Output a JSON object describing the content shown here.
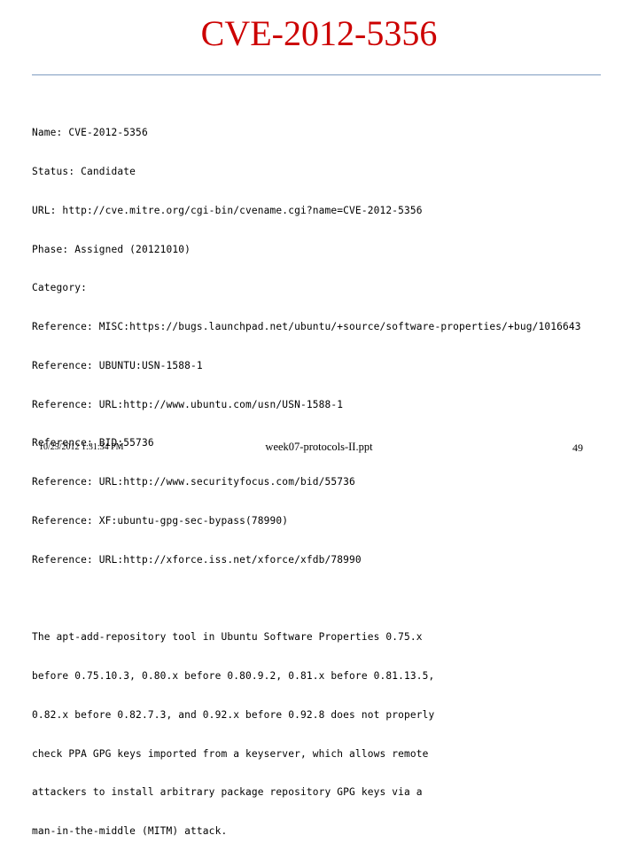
{
  "slide": {
    "title": "CVE-2012-5356",
    "accent_color": "#cc0000",
    "divider_color": "#7f9cc0"
  },
  "record": {
    "fields": [
      "Name: CVE-2012-5356",
      "Status: Candidate",
      "URL: http://cve.mitre.org/cgi-bin/cvename.cgi?name=CVE-2012-5356",
      "Phase: Assigned (20121010)",
      "Category:",
      "Reference: MISC:https://bugs.launchpad.net/ubuntu/+source/software-properties/+bug/1016643",
      "Reference: UBUNTU:USN-1588-1",
      "Reference: URL:http://www.ubuntu.com/usn/USN-1588-1",
      "Reference: BID:55736",
      "Reference: URL:http://www.securityfocus.com/bid/55736",
      "Reference: XF:ubuntu-gpg-sec-bypass(78990)",
      "Reference: URL:http://xforce.iss.net/xforce/xfdb/78990"
    ],
    "description": [
      "The apt-add-repository tool in Ubuntu Software Properties 0.75.x",
      "before 0.75.10.3, 0.80.x before 0.80.9.2, 0.81.x before 0.81.13.5,",
      "0.82.x before 0.82.7.3, and 0.92.x before 0.92.8 does not properly",
      "check PPA GPG keys imported from a keyserver, which allows remote",
      "attackers to install arbitrary package repository GPG keys via a",
      "man-in-the-middle (MITM) attack."
    ]
  },
  "footer": {
    "date": "10/25/2012 1:31:34 PM",
    "file": "week07-protocols-II.ppt",
    "page": "49"
  }
}
